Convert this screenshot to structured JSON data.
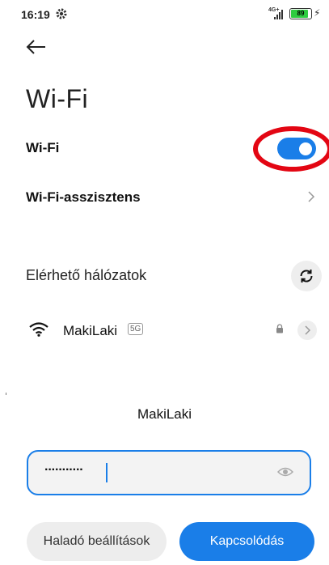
{
  "status_bar": {
    "time": "16:19",
    "network": "4G+",
    "battery": "89",
    "battery_level_percent": 89,
    "icons": [
      "gear-icon",
      "signal-icon",
      "battery-icon",
      "charging-icon"
    ]
  },
  "header": {
    "back_icon": "back-arrow-icon",
    "title": "Wi-Fi"
  },
  "settings": {
    "wifi_label": "Wi-Fi",
    "wifi_enabled": true,
    "assistant_label": "Wi-Fi-asszisztens"
  },
  "networks": {
    "section_label": "Elérhető hálózatok",
    "items": [
      {
        "name": "MakiLaki",
        "badge": "5G",
        "secured": true
      }
    ]
  },
  "dialog": {
    "title": "MakiLaki",
    "password_masked": "···········",
    "advanced_label": "Haladó beállítások",
    "connect_label": "Kapcsolódás"
  },
  "colors": {
    "accent": "#1a7ee8",
    "annotation": "#e30613",
    "background": "#ffffff"
  }
}
